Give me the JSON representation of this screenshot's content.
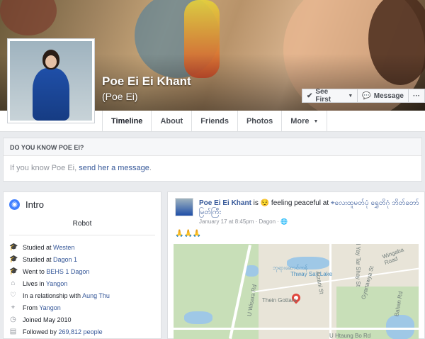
{
  "profile": {
    "name": "Poe Ei Ei Khant",
    "alternate_name": "(Poe Ei)"
  },
  "cover_actions": {
    "see_first": "See First",
    "message": "Message",
    "more": "···"
  },
  "nav": {
    "tabs": [
      {
        "label": "Timeline"
      },
      {
        "label": "About"
      },
      {
        "label": "Friends"
      },
      {
        "label": "Photos"
      },
      {
        "label": "More"
      }
    ]
  },
  "know_card": {
    "heading": "DO YOU KNOW POE EI?",
    "text_prefix": "If you know Poe Ei, ",
    "link_text": "send her a message",
    "text_suffix": "."
  },
  "intro": {
    "title": "Intro",
    "bio": "Robot",
    "items": [
      {
        "icon": "graduation-cap-icon",
        "text": "Studied at ",
        "link": "Westen"
      },
      {
        "icon": "graduation-cap-icon",
        "text": "Studied at ",
        "link": "Dagon 1"
      },
      {
        "icon": "graduation-cap-icon",
        "text": "Went to ",
        "link": "BEHS 1 Dagon"
      },
      {
        "icon": "home-icon",
        "text": "Lives in ",
        "link": "Yangon"
      },
      {
        "icon": "heart-icon",
        "text": "In a relationship with ",
        "link": "Aung Thu"
      },
      {
        "icon": "location-icon",
        "text": "From ",
        "link": "Yangon"
      },
      {
        "icon": "clock-icon",
        "text": "Joined May 2010",
        "link": ""
      },
      {
        "icon": "followers-icon",
        "text": "Followed by ",
        "link": "269,812 people"
      }
    ]
  },
  "post": {
    "author": "Poe Ei Ei Khant",
    "verb": " is ",
    "feeling": "feeling peaceful",
    "at": " at ",
    "place": "လေးထူမတ်ပုံ ရွှေတိဂုံ ဘိတ်တော်မြတ်ကြီး",
    "date": "January 17 at 8:45pm",
    "location": "Dagon",
    "text": "🙏🙏🙏",
    "map_labels": {
      "lake_my": "ဘုရားဆောင်ကန်",
      "lake_en": "Thway Say Lake",
      "place": "Thein Gottara",
      "road1": "U Wisara Rd",
      "road2": "Arzani St",
      "road3": "Gyartawya St",
      "road4": "Bahan Rd",
      "road5": "U Htaung Bo Rd",
      "road6": "Old Yay Tar Shay St",
      "road7": "Wingaba Road"
    }
  }
}
